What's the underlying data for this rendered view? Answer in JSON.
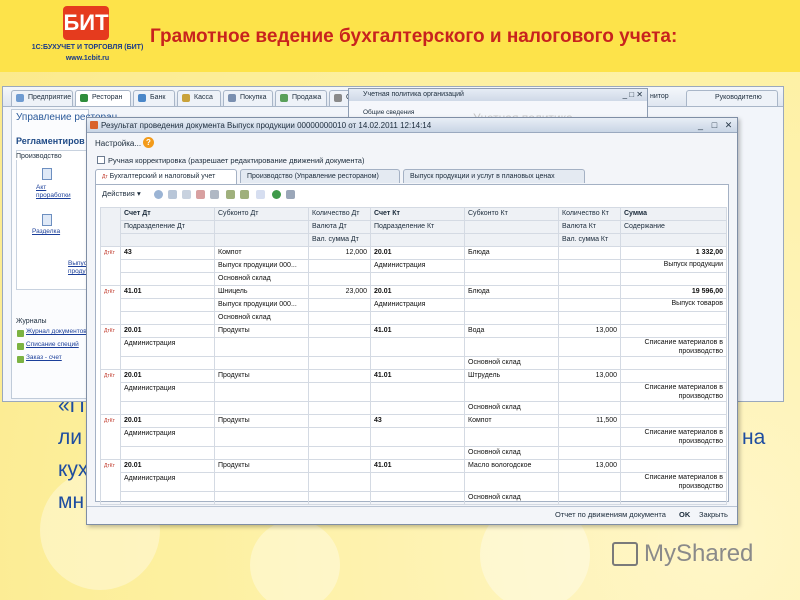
{
  "slide": {
    "title": "Грамотное ведение бухгалтерского и налогового учета:",
    "logo_mark": "БИТ",
    "logo_name": "1С:БУХУЧЕТ И ТОРГОВЛЯ (БИТ)",
    "logo_site": "www.1cbit.ru",
    "behind_text": [
      "«П",
      "ли",
      "на",
      "кух",
      "мн"
    ],
    "watermark": "MyShared",
    "colors": {
      "title": "#c8231e",
      "band": "#fde34a",
      "logo": "#e53b1e"
    }
  },
  "app": {
    "tabs": [
      "Предприятие",
      "Ресторан",
      "Банк",
      "Касса",
      "Покупка",
      "Продажа",
      "С"
    ],
    "monitor_tab": "нитор",
    "manager_tab": "Руководителю",
    "left_panel": {
      "title": "Управление ресторан",
      "subtitle": "Регламентиров",
      "group_label": "Производство",
      "links": [
        "Акт проработки",
        "Разделка",
        "Выпуск продукции"
      ],
      "journals_label": "Журналы",
      "journals": [
        "Журнал документов",
        "Списание специй",
        "Заказ - счет"
      ]
    }
  },
  "policy_window": {
    "title": "Учетная политика организаций",
    "tab": "Общие сведения",
    "watermark": "Учетная политика"
  },
  "dialog": {
    "title": "Результат проведения документа Выпуск продукции 00000000010 от 14.02.2011 12:14:14",
    "menu": "Настройка...",
    "checkbox_label": "Ручная корректировка (разрешает редактирование движений документа)",
    "tabs": [
      "Бухгалтерский и налоговый учет",
      "Производство (Управление рестораном)",
      "Выпуск продукции и услуг в плановых ценах"
    ],
    "toolbar_actions": "Действия",
    "columns": {
      "row1": [
        "Счет Дт",
        "Субконто Дт",
        "Количество Дт",
        "Счет Кт",
        "Субконто Кт",
        "Количество Кт",
        "Сумма"
      ],
      "row2": [
        "Подразделение Дт",
        "",
        "Валюта Дт",
        "Подразделение Кт",
        "",
        "Валюта Кт",
        "Содержание"
      ],
      "row3": [
        "",
        "",
        "Вал. сумма Дт",
        "",
        "",
        "Вал. сумма Кт",
        ""
      ]
    },
    "rows": [
      {
        "icon": "ДтКт",
        "l1": [
          "43",
          "Компот",
          "12,000",
          "20.01",
          "Блюда",
          "",
          "1 332,00"
        ],
        "l2": [
          "",
          "Выпуск продукции 000...",
          "",
          "Администрация",
          "",
          "",
          "Выпуск продукции"
        ],
        "l3": [
          "",
          "Основной склад",
          "",
          "",
          "",
          "",
          ""
        ]
      },
      {
        "icon": "ДтКт",
        "l1": [
          "41.01",
          "Шницель",
          "23,000",
          "20.01",
          "Блюда",
          "",
          "19 596,00"
        ],
        "l2": [
          "",
          "Выпуск продукции 000...",
          "",
          "Администрация",
          "",
          "",
          "Выпуск товаров"
        ],
        "l3": [
          "",
          "Основной склад",
          "",
          "",
          "",
          "",
          ""
        ]
      },
      {
        "icon": "ДтКт",
        "l1": [
          "20.01",
          "Продукты",
          "",
          "41.01",
          "Вода",
          "13,000",
          ""
        ],
        "l2": [
          "Администрация",
          "",
          "",
          "",
          "",
          "",
          "Списание материалов в производство"
        ],
        "l3": [
          "",
          "",
          "",
          "",
          "Основной склад",
          "",
          ""
        ]
      },
      {
        "icon": "ДтКт",
        "l1": [
          "20.01",
          "Продукты",
          "",
          "41.01",
          "Штрудель",
          "13,000",
          ""
        ],
        "l2": [
          "Администрация",
          "",
          "",
          "",
          "",
          "",
          "Списание материалов в производство"
        ],
        "l3": [
          "",
          "",
          "",
          "",
          "Основной склад",
          "",
          ""
        ]
      },
      {
        "icon": "ДтКт",
        "l1": [
          "20.01",
          "Продукты",
          "",
          "43",
          "Компот",
          "11,500",
          ""
        ],
        "l2": [
          "Администрация",
          "",
          "",
          "",
          "",
          "",
          "Списание материалов в производство"
        ],
        "l3": [
          "",
          "",
          "",
          "",
          "Основной склад",
          "",
          ""
        ]
      },
      {
        "icon": "ДтКт",
        "l1": [
          "20.01",
          "Продукты",
          "",
          "41.01",
          "Масло вологодское",
          "13,000",
          ""
        ],
        "l2": [
          "Администрация",
          "",
          "",
          "",
          "",
          "",
          "Списание материалов в производство"
        ],
        "l3": [
          "",
          "",
          "",
          "",
          "Основной склад",
          "",
          ""
        ]
      }
    ],
    "footer": {
      "report": "Отчет по движениям документа",
      "ok": "OK",
      "close": "Закрыть"
    }
  }
}
